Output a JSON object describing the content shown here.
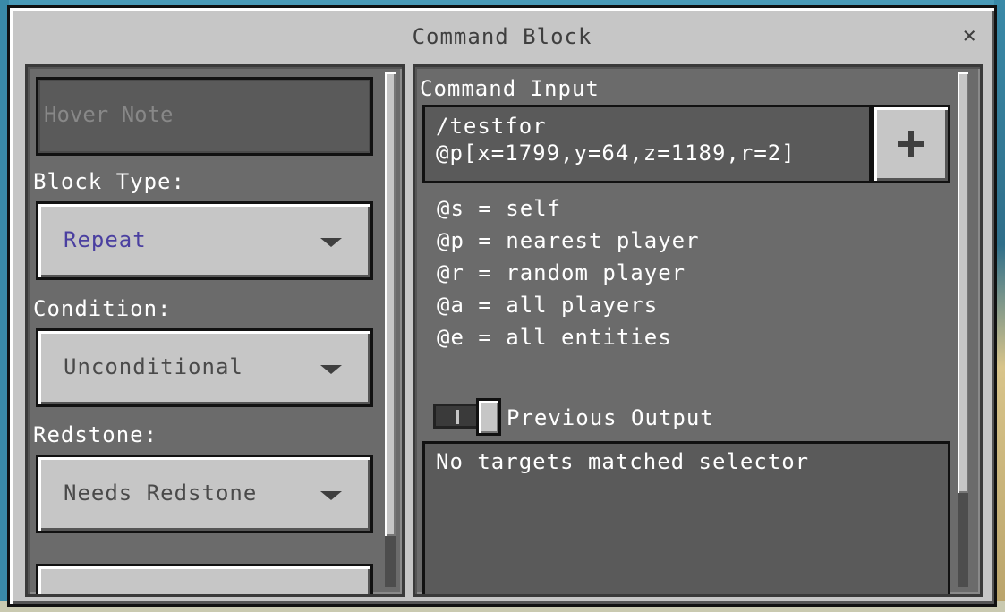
{
  "window": {
    "title": "Command Block",
    "close_symbol": "×"
  },
  "left": {
    "hover_note_placeholder": "Hover Note",
    "block_type_label": "Block Type:",
    "block_type_value": "Repeat",
    "condition_label": "Condition:",
    "condition_value": "Unconditional",
    "redstone_label": "Redstone:",
    "redstone_value": "Needs Redstone"
  },
  "right": {
    "command_input_label": "Command Input",
    "command_line1": "/testfor",
    "command_line2": "@p[x=1799,y=64,z=1189,r=2]",
    "selectors": [
      "@s = self",
      "@p = nearest player",
      "@r = random player",
      "@a = all players",
      "@e = all entities"
    ],
    "previous_output_label": "Previous Output",
    "output_text": "No targets matched selector"
  },
  "colors": {
    "accent_purple": "#4a3fa0",
    "panel_dark": "#6b6b6b",
    "window_gray": "#c6c6c6"
  }
}
